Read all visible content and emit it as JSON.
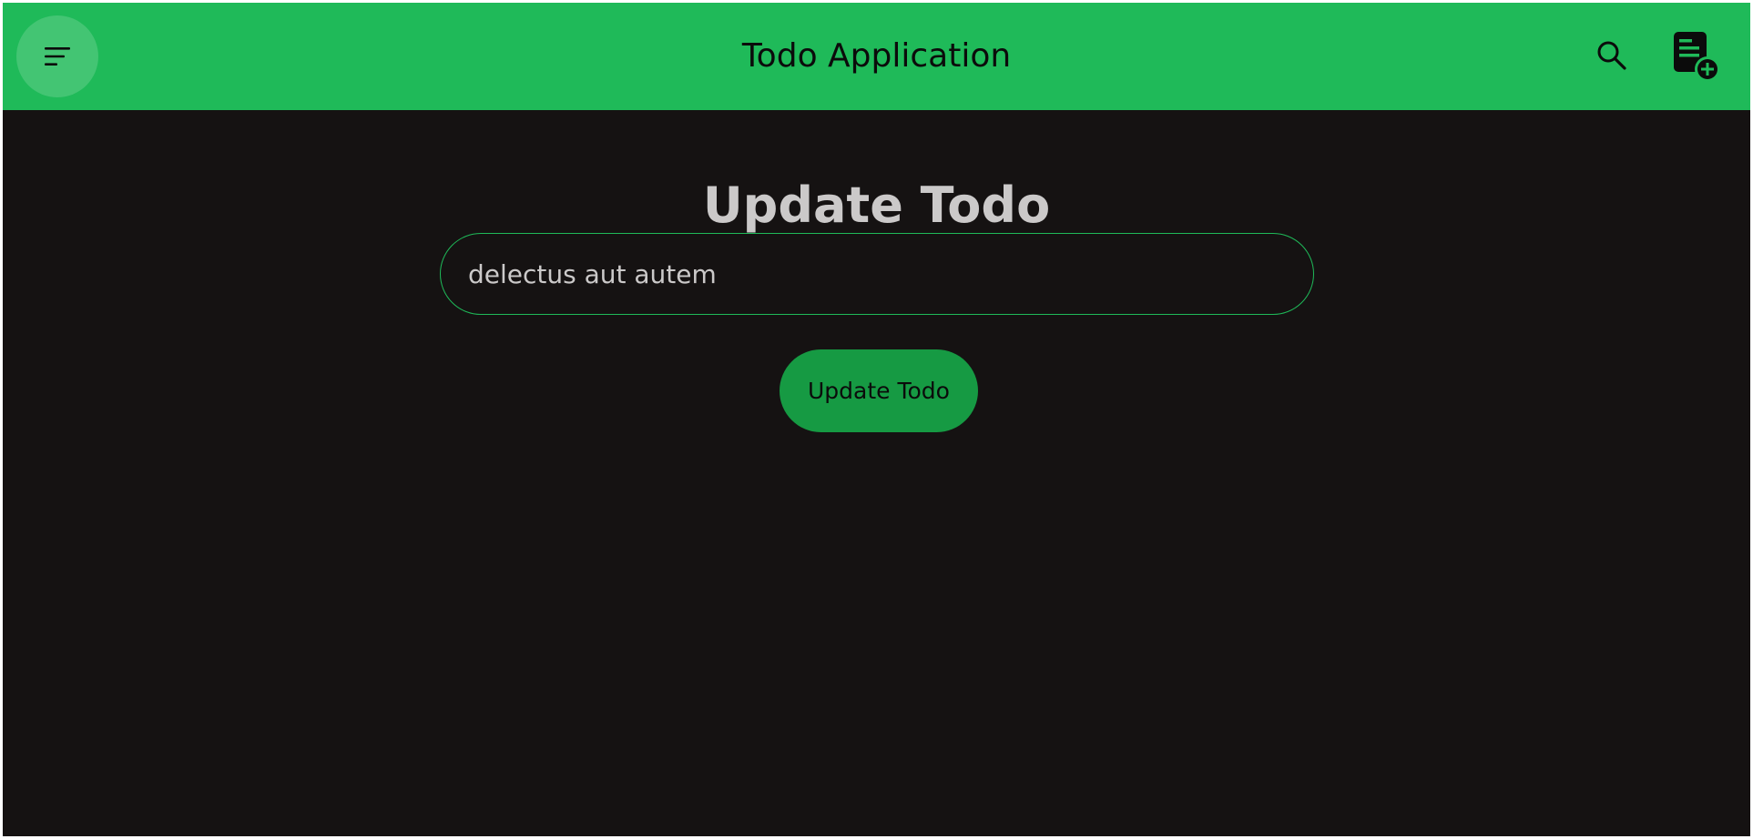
{
  "header": {
    "title": "Todo Application",
    "menu_icon": "menu-lines-icon",
    "search_icon": "search-icon",
    "add_icon": "add-note-icon"
  },
  "main": {
    "heading": "Update Todo",
    "todo_input": {
      "value": "delectus aut autem",
      "placeholder": ""
    },
    "update_button_label": "Update Todo"
  },
  "colors": {
    "header_bg": "#1fba59",
    "page_bg": "#151212",
    "button_bg": "#169a43",
    "text_light": "#cbc9c9",
    "input_border": "#1fba59"
  }
}
